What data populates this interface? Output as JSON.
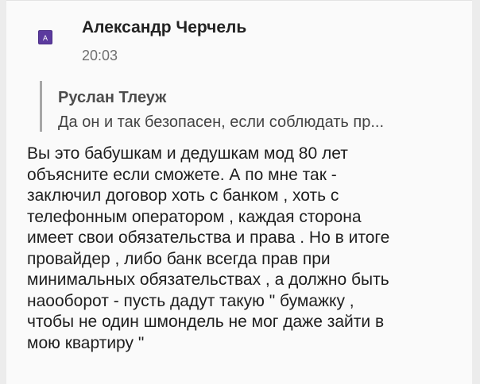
{
  "comment": {
    "avatar_letter": "A",
    "author": "Александр Черчель",
    "time": "20:03",
    "quote": {
      "author": "Руслан Тлеуж",
      "text": "Да он и так безопасен, если соблюдать пр..."
    },
    "body_lines": [
      "Вы это бабушкам и дедушкам мод 80 лет",
      "объясните если сможете. А по мне так -",
      "заключил договор хоть с банком , хоть с",
      "телефонным оператором , каждая сторона",
      "имеет свои обязательства и права . Но в итоге",
      "провайдер , либо банк всегда прав при",
      "минимальных обязательствах , а должно быть",
      "наооборот - пусть дадут такую \" бумажку ,",
      "чтобы не один шмондель не мог даже зайти в",
      "мою квартиру \""
    ]
  },
  "colors": {
    "avatar_bg": "#5b3a9e",
    "quote_border": "#a7a7a7",
    "card_bg": "#fafafa"
  }
}
